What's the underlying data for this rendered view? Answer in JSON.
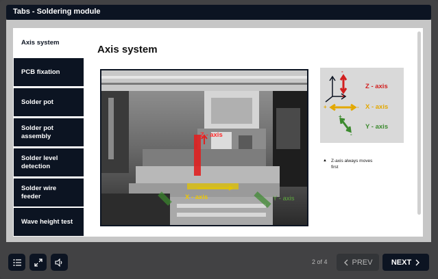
{
  "window": {
    "title": "Tabs - Soldering module"
  },
  "tabs": [
    {
      "label": "Axis system",
      "active": true
    },
    {
      "label": "PCB fixation"
    },
    {
      "label": "Solder pot"
    },
    {
      "label": "Solder pot assembly"
    },
    {
      "label": "Solder level detection"
    },
    {
      "label": "Solder wire feeder"
    },
    {
      "label": "Wave height test"
    }
  ],
  "content": {
    "title": "Axis system",
    "photo_labels": {
      "z": "Z - axis",
      "x": "X - axis",
      "y": "Y - axis"
    },
    "legend": {
      "z": {
        "label": "Z - axis",
        "color": "#d21f1f"
      },
      "x": {
        "label": "X - axis",
        "color": "#e3a800"
      },
      "y": {
        "label": "Y - axis",
        "color": "#3c8a2e"
      },
      "plus": "+",
      "minus": "-"
    },
    "note": "Z-axis always moves first"
  },
  "footer": {
    "page_indicator": "2 of 4",
    "prev_label": "PREV",
    "next_label": "NEXT"
  },
  "icons": {
    "menu": "list-icon",
    "fullscreen": "expand-icon",
    "audio": "volume-icon"
  }
}
